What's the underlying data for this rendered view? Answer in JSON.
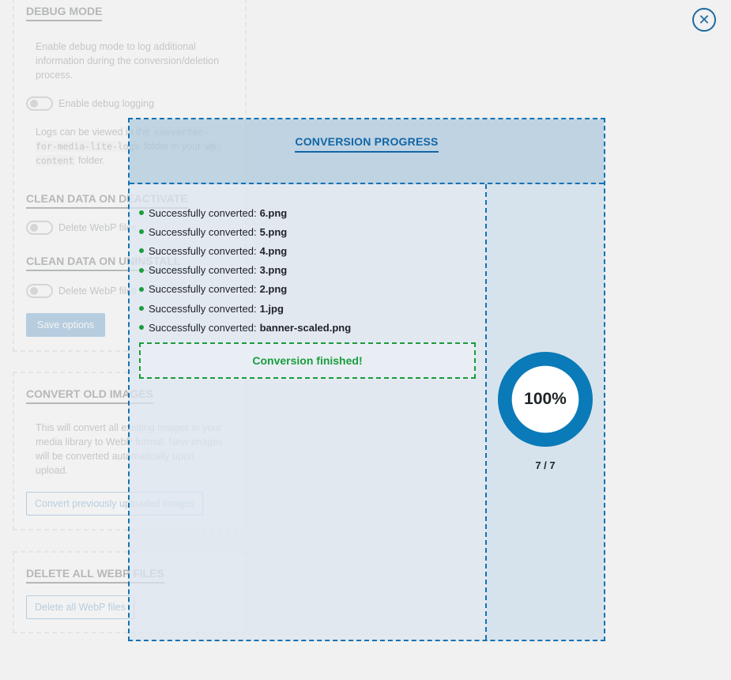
{
  "background": {
    "debug": {
      "heading": "DEBUG MODE",
      "description": "Enable debug mode to log additional information during the conversion/deletion process.",
      "toggle_label": "Enable debug logging",
      "logs_prefix": "Logs can be viewed in the",
      "logs_code": "converter-for-media-lite-logs",
      "logs_middle": "folder in your",
      "logs_code2": "wp-content",
      "logs_suffix": "folder."
    },
    "clean_deactivate": {
      "heading": "CLEAN DATA ON DEACTIVATE",
      "toggle_label": "Delete WebP files"
    },
    "clean_uninstall": {
      "heading": "CLEAN DATA ON UNINSTALL",
      "toggle_label": "Delete WebP files"
    },
    "save_button": "Save options",
    "convert_old": {
      "heading": "CONVERT OLD IMAGES",
      "description": "This will convert all existing images in your media library to WebP format. New images will be converted automatically upon upload.",
      "button": "Convert previously uploaded images"
    },
    "delete_all": {
      "heading": "DELETE ALL WEBP FILES",
      "button": "Delete all WebP files"
    }
  },
  "modal": {
    "title": "CONVERSION PROGRESS",
    "log_prefix": "Successfully converted:",
    "log_files": [
      "6.png",
      "5.png",
      "4.png",
      "3.png",
      "2.png",
      "1.jpg",
      "banner-scaled.png"
    ],
    "finished_message": "Conversion finished!",
    "progress": {
      "percent_label": "100%",
      "percent": 100,
      "count_label": "7 / 7"
    }
  },
  "colors": {
    "accent": "#0a7ab8",
    "success": "#1a9c3e",
    "ring_track": "#ffffff"
  },
  "icons": {
    "close": "close-circle-icon"
  }
}
